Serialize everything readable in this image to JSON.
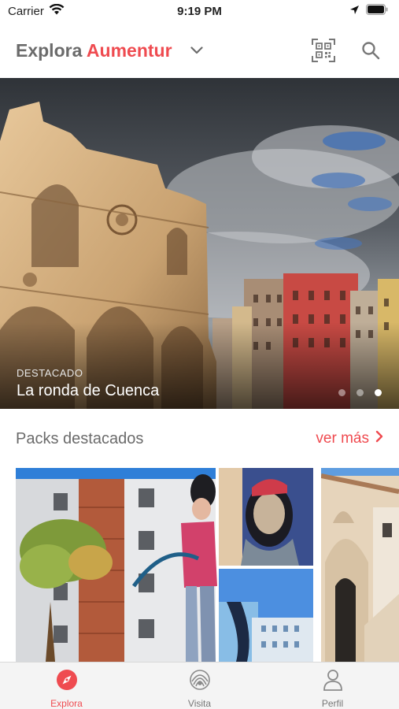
{
  "status_bar": {
    "carrier": "Carrier",
    "time": "9:19 PM"
  },
  "header": {
    "title_prefix": "Explora",
    "title_brand": "Aumentur",
    "brand_color": "#ef4b50",
    "icons": [
      "chevron-down-icon",
      "qr-code-icon",
      "search-icon"
    ]
  },
  "hero": {
    "eyebrow": "DESTACADO",
    "title": "La ronda de Cuenca",
    "slides_count": 3,
    "active_slide": 3
  },
  "section": {
    "title": "Packs destacados",
    "more_label": "ver más"
  },
  "tabs": [
    {
      "label": "Explora",
      "icon": "compass-icon",
      "active": true
    },
    {
      "label": "Visita",
      "icon": "ar-scan-icon",
      "active": false
    },
    {
      "label": "Perfil",
      "icon": "user-icon",
      "active": false
    }
  ]
}
